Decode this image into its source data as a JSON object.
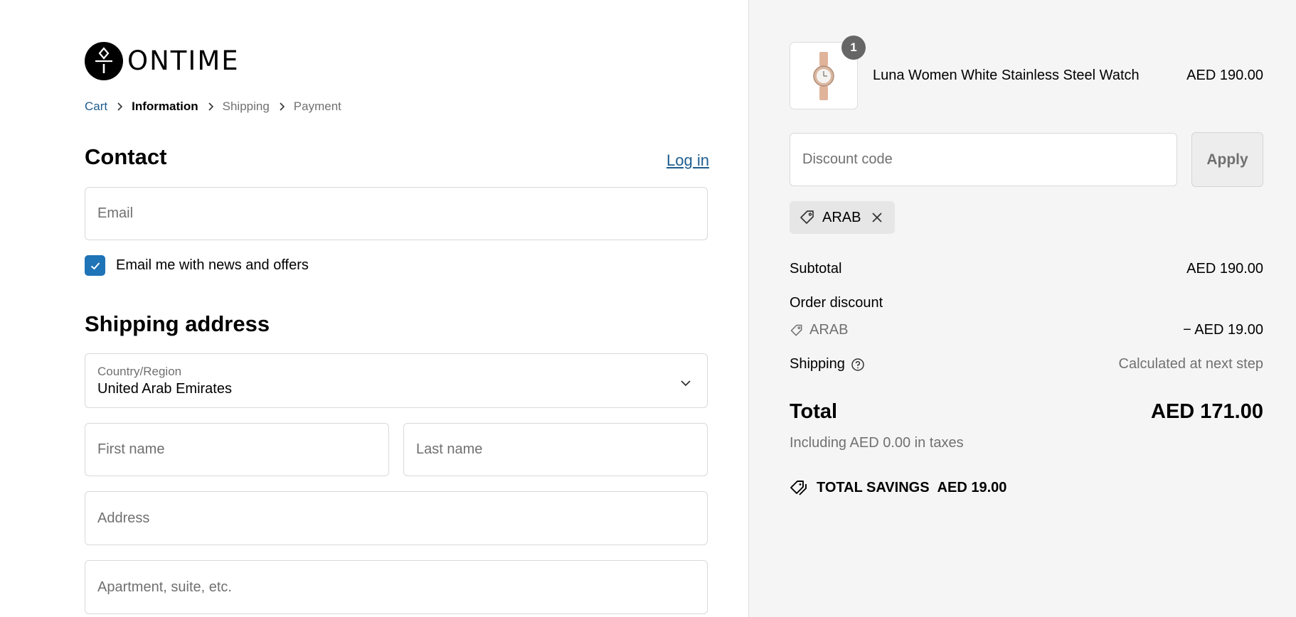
{
  "brand": {
    "name": "ONTIME"
  },
  "breadcrumb": {
    "items": [
      {
        "label": "Cart"
      },
      {
        "label": "Information"
      },
      {
        "label": "Shipping"
      },
      {
        "label": "Payment"
      }
    ]
  },
  "contact": {
    "heading": "Contact",
    "login_label": "Log in",
    "email_placeholder": "Email",
    "newsletter_label": "Email me with news and offers",
    "newsletter_checked": true
  },
  "shipping_address": {
    "heading": "Shipping address",
    "country_label": "Country/Region",
    "country_value": "United Arab Emirates",
    "first_name_placeholder": "First name",
    "last_name_placeholder": "Last name",
    "address_placeholder": "Address",
    "apartment_placeholder": "Apartment, suite, etc."
  },
  "order_summary": {
    "product": {
      "name": "Luna Women White Stainless Steel Watch",
      "price": "AED 190.00",
      "quantity": "1"
    },
    "discount_placeholder": "Discount code",
    "apply_label": "Apply",
    "applied_code": "ARAB",
    "subtotal_label": "Subtotal",
    "subtotal_value": "AED 190.00",
    "order_discount_label": "Order discount",
    "discount_code": "ARAB",
    "discount_value": "− AED 19.00",
    "shipping_label": "Shipping",
    "shipping_value": "Calculated at next step",
    "total_label": "Total",
    "total_value": "AED 171.00",
    "taxes_note": "Including AED 0.00 in taxes",
    "savings_label": "TOTAL SAVINGS",
    "savings_value": "AED 19.00"
  },
  "icons": {
    "logo": "ontime-logo-mark",
    "breadcrumb_separator": "chevron-right-icon",
    "checkbox": "check-icon",
    "country_select": "chevron-down-icon",
    "tag": "tag-icon",
    "remove": "close-icon",
    "help": "question-circle-icon",
    "savings": "tags-icon"
  },
  "colors": {
    "accent": "#1f73b7",
    "link": "#1f5d8f",
    "summary_background": "#f5f5f5"
  }
}
